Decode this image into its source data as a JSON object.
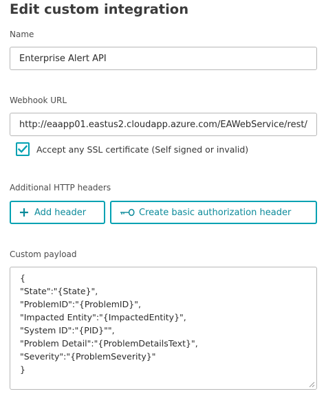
{
  "page": {
    "title": "Edit custom integration"
  },
  "name_field": {
    "label": "Name",
    "value": "Enterprise Alert API"
  },
  "webhook_field": {
    "label": "Webhook URL",
    "value": "http://eaapp01.eastus2.cloudapp.azure.com/EAWebService/rest/"
  },
  "ssl_checkbox": {
    "label": "Accept any SSL certificate (Self signed or invalid)",
    "checked": true
  },
  "headers": {
    "label": "Additional HTTP headers",
    "add_header_label": "Add header",
    "add_header_icon": "plus-icon",
    "basic_auth_label": "Create basic authorization header",
    "basic_auth_icon": "key-icon"
  },
  "payload": {
    "label": "Custom payload",
    "lines": [
      "{",
      "\"State\":\"{State}\",",
      "\"ProblemID\":\"{ProblemID}\",",
      "\"Impacted Entity\":\"{ImpactedEntity}\",",
      "\"System ID\":\"{PID}\"\",",
      "\"Problem Detail\":\"{ProblemDetailsText}\",",
      "\"Severity\":\"{ProblemSeverity}\"",
      "}"
    ]
  },
  "colors": {
    "accent": "#00a1b2",
    "accent_text": "#0b8a9a",
    "border": "#b7b7b7",
    "text": "#353535"
  }
}
